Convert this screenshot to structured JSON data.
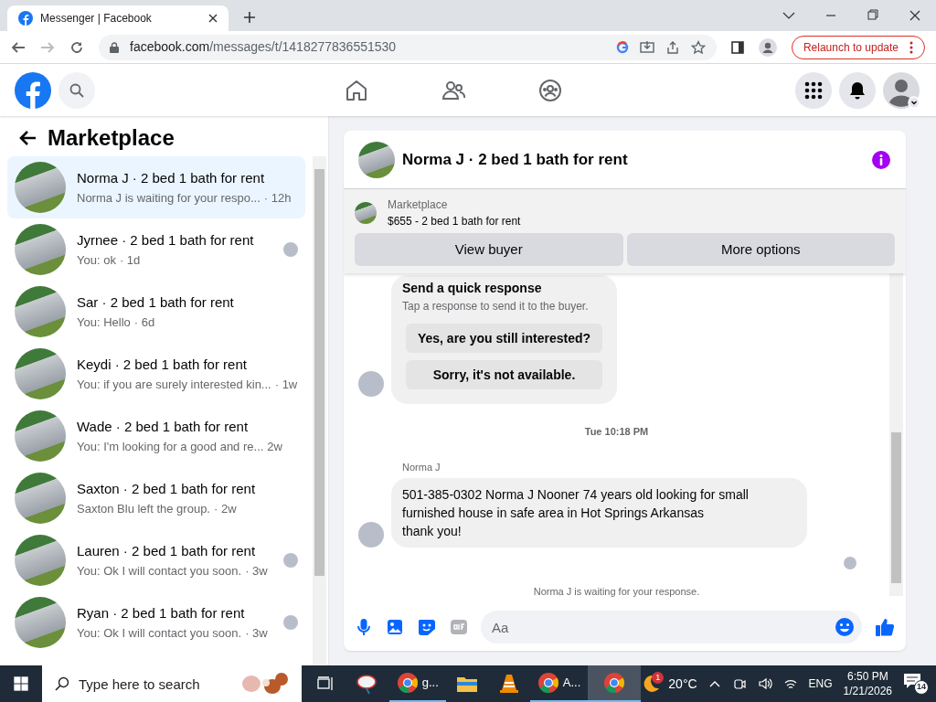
{
  "browser": {
    "tab_title": "Messenger | Facebook",
    "url_host": "facebook.com",
    "url_path": "/messages/t/1418277836551530",
    "relaunch_button": "Relaunch to update"
  },
  "sidebar": {
    "title": "Marketplace",
    "conversations": [
      {
        "title": "Norma J · 2 bed 1 bath for rent",
        "preview": "Norma J is waiting for your respo...",
        "time": "· 12h",
        "selected": true,
        "read_receipt": false
      },
      {
        "title": "Jyrnee · 2 bed 1 bath for rent",
        "preview": "You: ok",
        "time": "· 1d",
        "selected": false,
        "read_receipt": true
      },
      {
        "title": "Sar · 2 bed 1 bath for rent",
        "preview": "You: Hello",
        "time": "· 6d",
        "selected": false,
        "read_receipt": false
      },
      {
        "title": "Keydi · 2 bed 1 bath for rent",
        "preview": "You: if you are surely interested kin...",
        "time": "· 1w",
        "selected": false,
        "read_receipt": false
      },
      {
        "title": "Wade · 2 bed 1 bath for rent",
        "preview": "You: I'm looking for a good and re...",
        "time": "2w",
        "selected": false,
        "read_receipt": false
      },
      {
        "title": "Saxton · 2 bed 1 bath for rent",
        "preview": "Saxton Blu left the group.",
        "time": "· 2w",
        "selected": false,
        "read_receipt": false
      },
      {
        "title": "Lauren · 2 bed 1 bath for rent",
        "preview": "You: Ok I will contact you soon.",
        "time": "· 3w",
        "selected": false,
        "read_receipt": true
      },
      {
        "title": "Ryan · 2 bed 1 bath for rent",
        "preview": "You: Ok I will contact you soon.",
        "time": "· 3w",
        "selected": false,
        "read_receipt": true
      }
    ]
  },
  "chat": {
    "title": "Norma J · 2 bed 1 bath for rent",
    "listing": {
      "label": "Marketplace",
      "title": "$655 - 2 bed 1 bath for rent"
    },
    "buttons": [
      "View buyer",
      "More options"
    ],
    "quick_response": {
      "title": "Send a quick response",
      "subtitle": "Tap a response to send it to the buyer.",
      "options": [
        "Yes, are you still interested?",
        "Sorry, it's not available."
      ]
    },
    "timestamp": "Tue 10:18 PM",
    "message": {
      "sender": "Norma J",
      "text": "501-385-0302 Norma J Nooner 74 years old looking for small furnished house in safe area in Hot Springs Arkansas\nthank you!"
    },
    "status": "Norma J is waiting for your response.",
    "composer": {
      "placeholder": "Aa"
    }
  },
  "taskbar": {
    "search_placeholder": "Type here to search",
    "apps": [
      {
        "kind": "icon"
      },
      {
        "kind": "chrome",
        "label": "g..."
      },
      {
        "kind": "folder"
      },
      {
        "kind": "vlc"
      },
      {
        "kind": "chrome",
        "label": "A..."
      },
      {
        "kind": "chrome_active"
      }
    ],
    "weather_badge": "1",
    "temperature": "20°C",
    "language": "ENG",
    "time": "6:50 PM",
    "date": "1/21/2026",
    "notifications": "14"
  }
}
